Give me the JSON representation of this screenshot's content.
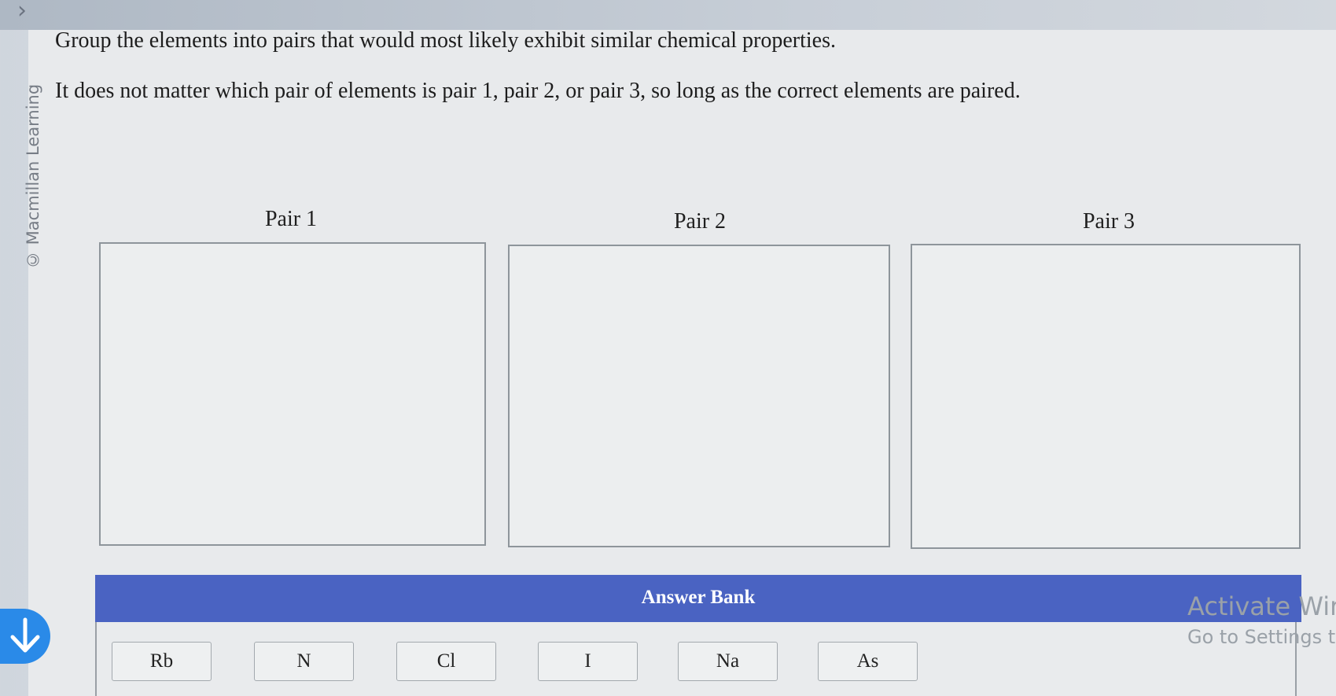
{
  "watermark": "© Macmillan Learning",
  "instructions": {
    "line1": "Group the elements into pairs that would most likely exhibit similar chemical properties.",
    "line2": "It does not matter which pair of elements is pair 1, pair 2, or pair 3, so long as the correct elements are paired."
  },
  "pairs": [
    {
      "label": "Pair 1"
    },
    {
      "label": "Pair 2"
    },
    {
      "label": "Pair 3"
    }
  ],
  "answer_bank": {
    "title": "Answer Bank",
    "items": [
      "Rb",
      "N",
      "Cl",
      "I",
      "Na",
      "As"
    ]
  },
  "overlay": {
    "activate_line1": "Activate Wir",
    "activate_line2": "Go to Settings to"
  },
  "icons": {
    "top_chevron": "chevron-right-icon",
    "scroll_button": "arrow-down-icon"
  },
  "colors": {
    "bank_header": "#4a63c2",
    "scroll_button": "#2a8ae8"
  }
}
